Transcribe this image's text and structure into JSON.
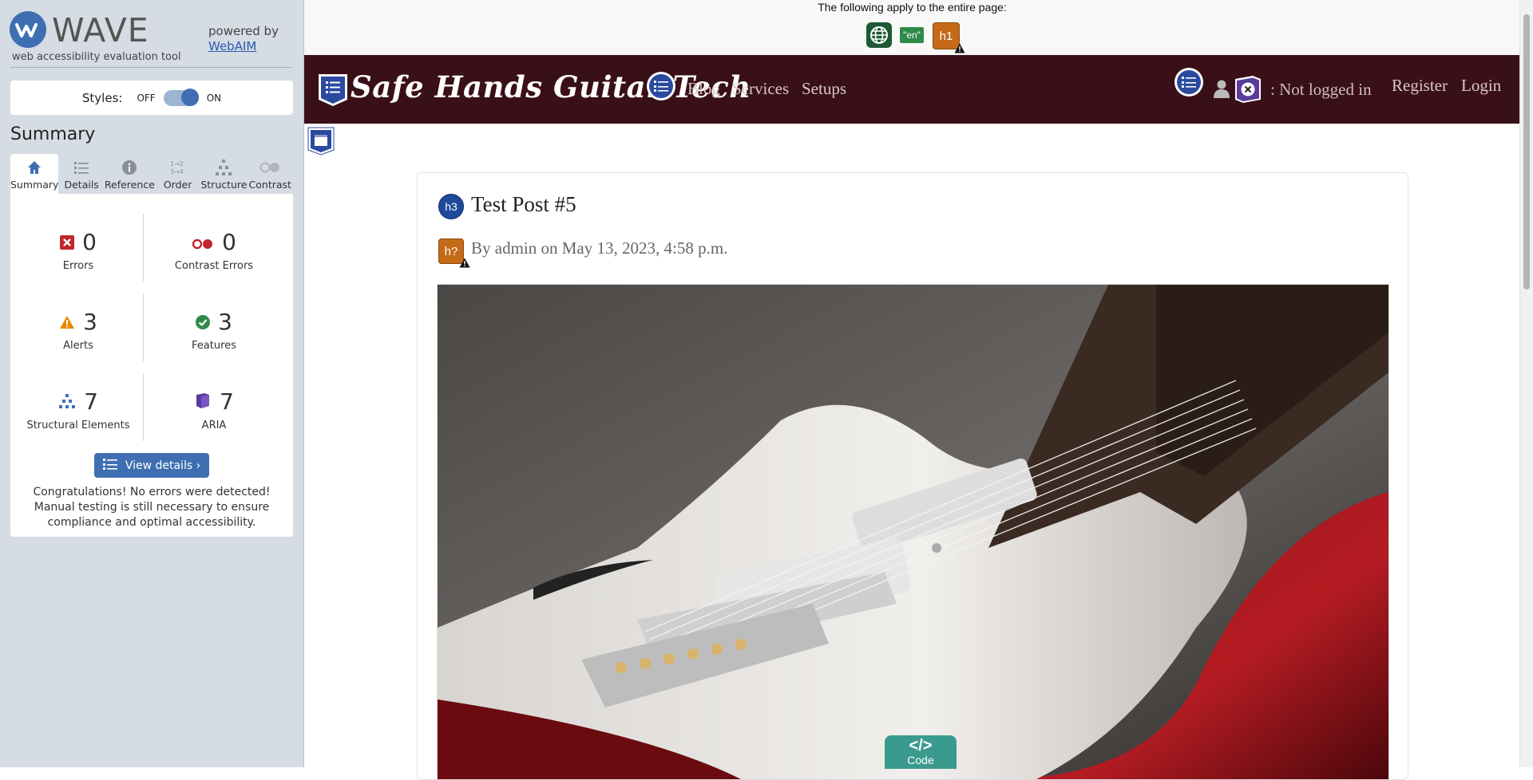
{
  "wave": {
    "title": "WAVE",
    "subtitle": "web accessibility evaluation tool",
    "powered_by": "powered by",
    "webaim_link": "WebAIM",
    "styles_label": "Styles:",
    "styles_off": "OFF",
    "styles_on": "ON",
    "styles_enabled": true,
    "summary_heading": "Summary",
    "tabs": [
      {
        "label": "Summary",
        "icon": "home-icon",
        "active": true
      },
      {
        "label": "Details",
        "icon": "list-icon",
        "active": false
      },
      {
        "label": "Reference",
        "icon": "info-icon",
        "active": false
      },
      {
        "label": "Order",
        "icon": "order-icon",
        "active": false
      },
      {
        "label": "Structure",
        "icon": "structure-icon",
        "active": false
      },
      {
        "label": "Contrast",
        "icon": "contrast-icon",
        "active": false
      }
    ],
    "stats": {
      "errors": {
        "count": "0",
        "label": "Errors"
      },
      "contrast_errors": {
        "count": "0",
        "label": "Contrast Errors"
      },
      "alerts": {
        "count": "3",
        "label": "Alerts"
      },
      "features": {
        "count": "3",
        "label": "Features"
      },
      "structural": {
        "count": "7",
        "label": "Structural Elements"
      },
      "aria": {
        "count": "7",
        "label": "ARIA"
      }
    },
    "view_details_button": "View details ›",
    "congrats": "Congratulations! No errors were detected! Manual testing is still necessary to ensure compliance and optimal accessibility."
  },
  "page": {
    "applies_text": "The following apply to the entire page:",
    "page_icons": [
      "language-icon",
      "lang-en-icon",
      "h1-alert-icon"
    ],
    "lang_badge": "\"en\"",
    "h1_badge": "h1",
    "brand": "Safe Hands Guitar Tech",
    "nav": [
      "Blog",
      "Services",
      "Setups"
    ],
    "not_logged_in": ": Not logged in",
    "register": "Register",
    "login": "Login",
    "h3_badge": "h3",
    "post_title": "Test Post #5",
    "h2_badge": "h?",
    "byline": "By admin on May 13, 2023, 4:58 p.m.",
    "code_badge_glyph": "</>",
    "code_badge_label": "Code"
  },
  "colors": {
    "wave_blue": "#3f6fb2",
    "navbar": "#3a1018",
    "error_red": "#c0272d",
    "alert_orange": "#e68a00",
    "feature_green": "#2f8a4a",
    "aria_purple": "#5a3a9a",
    "code_teal": "#3b9a8e"
  }
}
